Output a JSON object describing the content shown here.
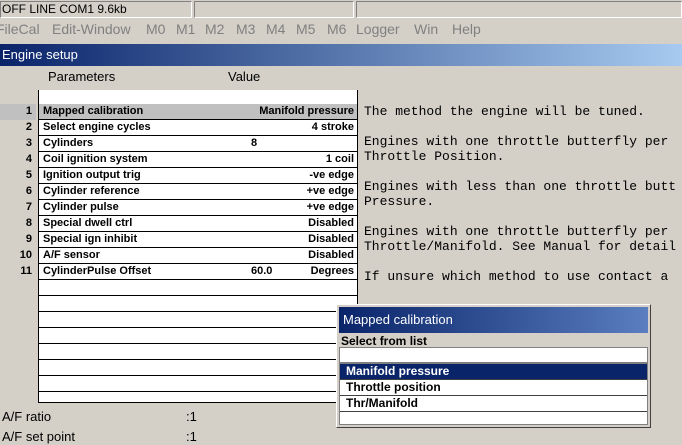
{
  "status": {
    "text": "OFF LINE COM1 9.6kb"
  },
  "menu": [
    "FileCal",
    "Edit-Window",
    "M0",
    "M1",
    "M2",
    "M3",
    "M4",
    "M5",
    "M6",
    "Logger",
    "Win",
    "Help"
  ],
  "window_title": "Engine setup",
  "headers": {
    "parameters": "Parameters",
    "value": "Value"
  },
  "rows": [
    {
      "num": "1",
      "name": "Mapped calibration",
      "value": "Manifold pressure",
      "mid": ""
    },
    {
      "num": "2",
      "name": "Select engine cycles",
      "value": "4 stroke",
      "mid": ""
    },
    {
      "num": "3",
      "name": "Cylinders",
      "value": "",
      "mid": "8"
    },
    {
      "num": "4",
      "name": "Coil ignition system",
      "value": "1 coil",
      "mid": ""
    },
    {
      "num": "5",
      "name": "Ignition output trig",
      "value": "-ve edge",
      "mid": ""
    },
    {
      "num": "6",
      "name": "Cylinder reference",
      "value": "+ve edge",
      "mid": ""
    },
    {
      "num": "7",
      "name": "Cylinder pulse",
      "value": "+ve edge",
      "mid": ""
    },
    {
      "num": "8",
      "name": "Special dwell ctrl",
      "value": "Disabled",
      "mid": ""
    },
    {
      "num": "9",
      "name": "Special ign inhibit",
      "value": "Disabled",
      "mid": ""
    },
    {
      "num": "10",
      "name": "A/F sensor",
      "value": "Disabled",
      "mid": ""
    },
    {
      "num": "11",
      "name": "CylinderPulse Offset",
      "value": "Degrees",
      "mid": "60.0"
    }
  ],
  "help_lines": [
    "The method the engine will be tuned.",
    "",
    "Engines with one throttle butterfly per",
    "Throttle Position.",
    "",
    "Engines with less than one throttle butt",
    "Pressure.",
    "",
    "Engines with one throttle butterfly per",
    "Throttle/Manifold. See Manual for detail",
    "",
    "If unsure which method to use contact a"
  ],
  "bottom": [
    {
      "label": "A/F ratio",
      "value": ":1"
    },
    {
      "label": "A/F set point",
      "value": ":1"
    }
  ],
  "popup": {
    "title": "Mapped calibration",
    "subtitle": "Select from list",
    "options": [
      "Manifold pressure",
      "Throttle position",
      "Thr/Manifold"
    ],
    "selected_index": 0
  }
}
